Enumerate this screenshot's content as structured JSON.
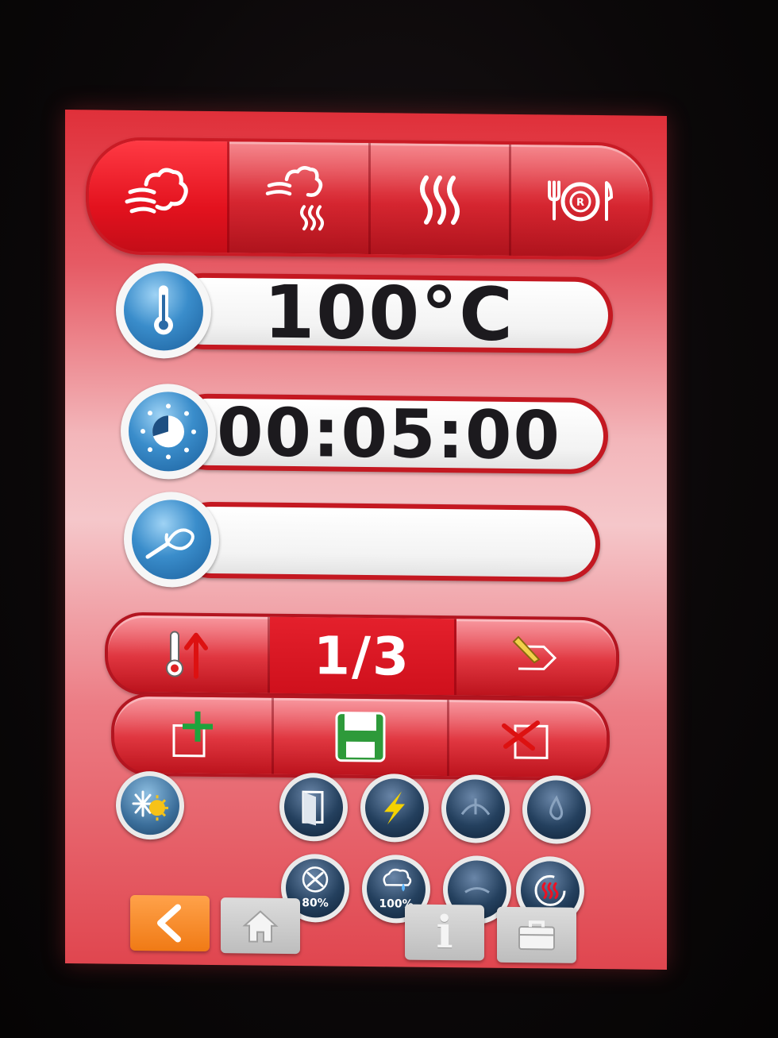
{
  "modes": [
    {
      "id": "steam",
      "icon": "steam-cloud-icon",
      "active": true
    },
    {
      "id": "combi",
      "icon": "steam-heat-icon",
      "active": false
    },
    {
      "id": "convection",
      "icon": "hot-air-icon",
      "active": false
    },
    {
      "id": "regeneration",
      "icon": "plate-regeneration-icon",
      "active": false
    }
  ],
  "temperature": {
    "value": "100°C",
    "icon": "thermometer-icon"
  },
  "time": {
    "value": "00:05:00",
    "icon": "timer-dial-icon"
  },
  "probe": {
    "value": "",
    "icon": "core-probe-icon"
  },
  "program_bar": {
    "preheat_icon": "thermometer-up-icon",
    "step": "1/3",
    "edit_icon": "edit-next-icon"
  },
  "step_bar": {
    "add_icon": "add-step-icon",
    "save_icon": "floppy-save-icon",
    "delete_icon": "delete-step-icon"
  },
  "functions": {
    "season_icon": "snow-sun-icon",
    "door_icon": "door-icon",
    "power_icon": "lightning-icon",
    "fan_percent": "80%",
    "humidity_percent": "100%"
  },
  "nav": {
    "info_label": "i"
  },
  "colors": {
    "panel_red": "#de2a34",
    "accent_blue": "#3a8dcb",
    "back_orange": "#f07a15"
  }
}
